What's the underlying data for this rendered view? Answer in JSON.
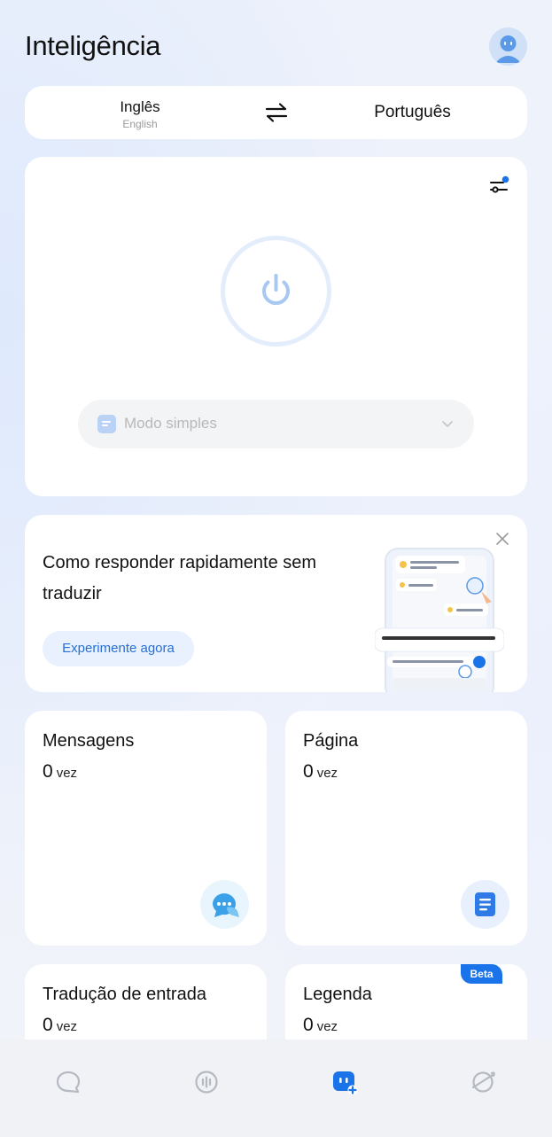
{
  "header": {
    "title": "Inteligência",
    "avatar_icon": "avatar-icon"
  },
  "languages": {
    "source": "Inglês",
    "source_native": "English",
    "target": "Português",
    "swap_icon": "swap-arrows-icon"
  },
  "translator": {
    "settings_icon": "sliders-icon",
    "power_icon": "power-icon",
    "mode_label": "Modo simples",
    "mode_icon": "document-icon"
  },
  "tip": {
    "text": "Como responder rapidamente sem traduzir",
    "button_label": "Experimente agora",
    "close_icon": "close-icon"
  },
  "stats": [
    {
      "title": "Mensagens",
      "count": "0",
      "unit": "vez",
      "icon": "chat-bubble-icon"
    },
    {
      "title": "Página",
      "count": "0",
      "unit": "vez",
      "icon": "page-icon"
    },
    {
      "title": "Tradução de entrada",
      "count": "0",
      "unit": "vez"
    },
    {
      "title": "Legenda",
      "count": "0",
      "unit": "vez",
      "badge": "Beta"
    }
  ],
  "bottom_nav": [
    {
      "icon": "chat-icon",
      "active": false
    },
    {
      "icon": "voice-icon",
      "active": false
    },
    {
      "icon": "assistant-icon",
      "active": true
    },
    {
      "icon": "explore-icon",
      "active": false
    }
  ],
  "colors": {
    "accent": "#1a73e8",
    "background": "#eef2fb",
    "card": "#ffffff"
  }
}
